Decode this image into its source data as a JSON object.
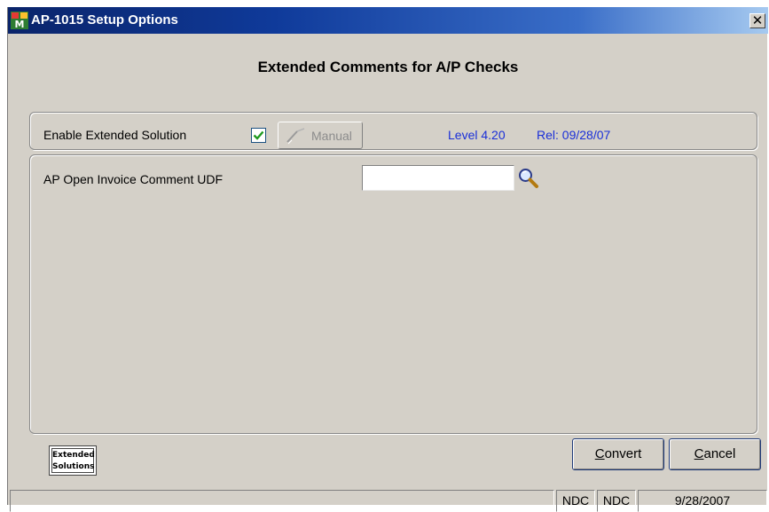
{
  "window": {
    "title": "AP-1015 Setup Options",
    "close_icon": "close-icon",
    "app_icon": "app-icon"
  },
  "heading": "Extended Comments for A/P Checks",
  "enable_row": {
    "label": "Enable Extended Solution",
    "checkbox_checked": true,
    "manual_label": "Manual",
    "level": "Level 4.20",
    "release": "Rel: 09/28/07"
  },
  "udf_row": {
    "label": "AP Open Invoice Comment UDF",
    "value": "",
    "lookup_icon": "magnifier-icon"
  },
  "logo": {
    "line1": "Extended",
    "line2": "Solutions"
  },
  "buttons": {
    "convert_mnemonic": "C",
    "convert_rest": "onvert",
    "cancel_mnemonic": "C",
    "cancel_rest": "ancel"
  },
  "status_bar": {
    "pane1": "",
    "pane2": "NDC",
    "pane3": "NDC",
    "pane4": "9/28/2007"
  },
  "colors": {
    "face": "#d4d0c8",
    "title_start": "#0a246a",
    "title_end": "#a6caf0",
    "accent_text": "#1a2fd8",
    "check": "#1f9a1f"
  }
}
